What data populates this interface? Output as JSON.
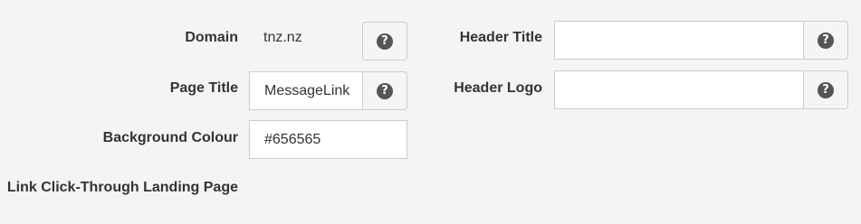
{
  "form": {
    "domain": {
      "label": "Domain",
      "value": "tnz.nz",
      "help_icon": "question-circle-icon"
    },
    "page_title": {
      "label": "Page Title",
      "value": "MessageLink",
      "help_icon": "question-circle-icon"
    },
    "background_colour": {
      "label": "Background Colour",
      "value": "#656565"
    },
    "link_click_through": {
      "label": "Link Click-Through Landing Page"
    },
    "header_title": {
      "label": "Header Title",
      "value": "",
      "help_icon": "question-circle-icon"
    },
    "header_logo": {
      "label": "Header Logo",
      "value": "",
      "help_icon": "question-circle-icon"
    },
    "help_glyph": "?"
  }
}
